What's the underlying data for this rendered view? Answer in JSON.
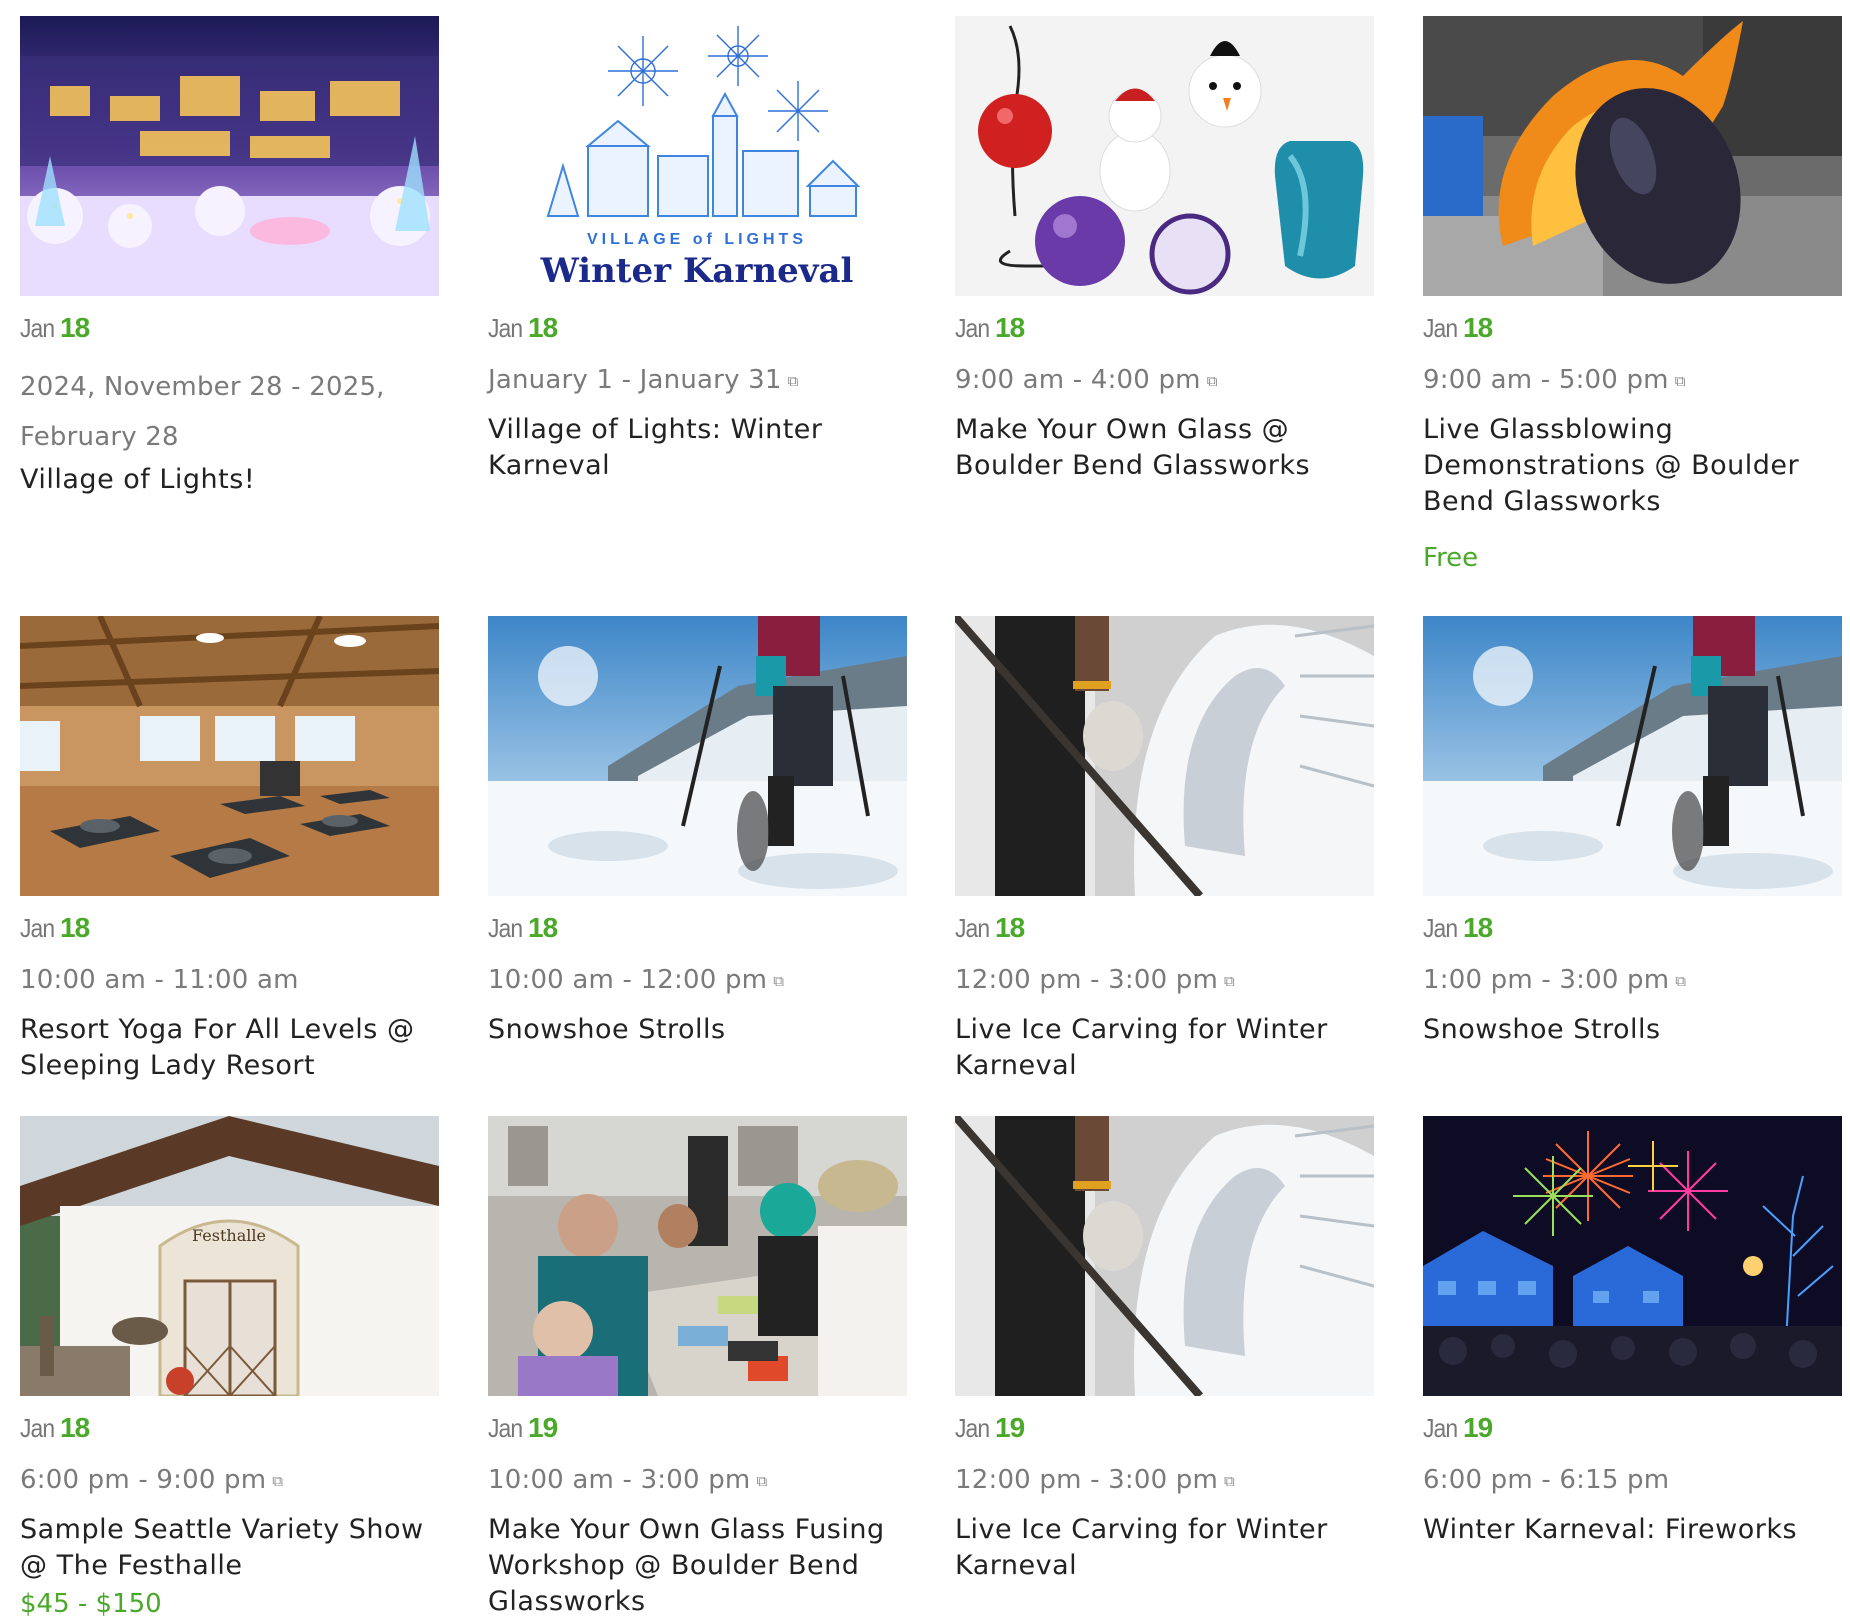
{
  "events": [
    {
      "month": "Jan",
      "day": "18",
      "time": "2024, November 28 - 2025, February 28",
      "recurring": false,
      "title": "Village of Lights!",
      "price": "",
      "image": "village-night-lights-photo"
    },
    {
      "month": "Jan",
      "day": "18",
      "time": "January 1 - January 31",
      "recurring": true,
      "title": "Village of Lights: Winter Karneval",
      "price": "",
      "image": "winter-karneval-logo",
      "logo": {
        "line1": "VILLAGE of LIGHTS",
        "line2": "Winter Karneval"
      }
    },
    {
      "month": "Jan",
      "day": "18",
      "time": "9:00 am - 4:00 pm",
      "recurring": true,
      "title": "Make Your Own Glass @ Boulder Bend Glassworks",
      "price": "",
      "image": "glass-ornaments-photo"
    },
    {
      "month": "Jan",
      "day": "18",
      "time": "9:00 am - 5:00 pm",
      "recurring": true,
      "title": "Live Glassblowing Demonstrations @ Boulder Bend Glassworks",
      "price": "Free",
      "image": "glassblowing-fire-photo"
    },
    {
      "month": "Jan",
      "day": "18",
      "time": "10:00 am - 11:00 am",
      "recurring": false,
      "title": "Resort Yoga For All Levels @ Sleeping Lady Resort",
      "price": "",
      "image": "yoga-studio-photo"
    },
    {
      "month": "Jan",
      "day": "18",
      "time": "10:00 am - 12:00 pm",
      "recurring": true,
      "title": "Snowshoe Strolls",
      "price": "",
      "image": "snowshoe-photo"
    },
    {
      "month": "Jan",
      "day": "18",
      "time": "12:00 pm - 3:00 pm",
      "recurring": true,
      "title": "Live Ice Carving for Winter Karneval",
      "price": "",
      "image": "ice-carving-photo"
    },
    {
      "month": "Jan",
      "day": "18",
      "time": "1:00 pm - 3:00 pm",
      "recurring": true,
      "title": "Snowshoe Strolls",
      "price": "",
      "image": "snowshoe-photo"
    },
    {
      "month": "Jan",
      "day": "18",
      "time": "6:00 pm - 9:00 pm",
      "recurring": true,
      "title": "Sample Seattle Variety Show @ The Festhalle",
      "price": "$45 - $150",
      "image": "festhalle-building-photo"
    },
    {
      "month": "Jan",
      "day": "19",
      "time": "10:00 am - 3:00 pm",
      "recurring": true,
      "title": "Make Your Own Glass Fusing Workshop @ Boulder Bend Glassworks",
      "price": "",
      "image": "glass-fusing-workshop-photo"
    },
    {
      "month": "Jan",
      "day": "19",
      "time": "12:00 pm - 3:00 pm",
      "recurring": true,
      "title": "Live Ice Carving for Winter Karneval",
      "price": "",
      "image": "ice-carving-photo"
    },
    {
      "month": "Jan",
      "day": "19",
      "time": "6:00 pm - 6:15 pm",
      "recurring": false,
      "title": "Winter Karneval: Fireworks",
      "price": "",
      "image": "fireworks-village-photo"
    }
  ],
  "recurring_icon": "⧉",
  "colors": {
    "accent": "#4aa82a",
    "muted": "#7a7a7a",
    "text": "#222222"
  }
}
